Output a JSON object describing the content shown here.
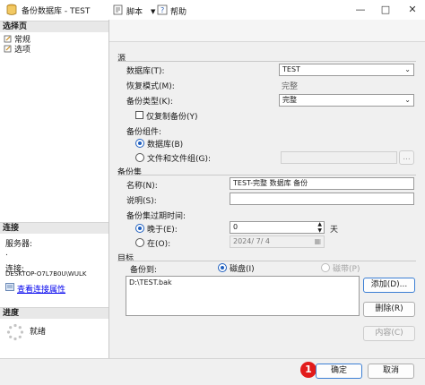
{
  "window": {
    "title": "备份数据库 - TEST",
    "buttons": {
      "minimize": "—",
      "maximize": "□",
      "close": "✕"
    }
  },
  "left": {
    "select_page_header": "选择页",
    "pages": [
      "常规",
      "选项"
    ],
    "connection_header": "连接",
    "server_label": "服务器:",
    "server_value": ".",
    "connection_label": "连接:",
    "connection_value": "DESKTOP-O7L7B0U\\WULK",
    "view_properties_link": "查看连接属性",
    "progress_header": "进度",
    "progress_status": "就绪"
  },
  "toolbar": {
    "script_label": "脚本",
    "help_label": "帮助"
  },
  "source": {
    "group_label": "源",
    "database_label": "数据库(T):",
    "database_value": "TEST",
    "recovery_label": "恢复模式(M):",
    "recovery_value": "完整",
    "backup_type_label": "备份类型(K):",
    "backup_type_value": "完整",
    "copy_only_label": "仅复制备份(Y)",
    "component_label": "备份组件:",
    "component_database": "数据库(B)",
    "component_files": "文件和文件组(G):",
    "browse_label": "..."
  },
  "backup_set": {
    "group_label": "备份集",
    "name_label": "名称(N):",
    "name_value": "TEST-完整 数据库 备份",
    "description_label": "说明(S):",
    "description_value": "",
    "expire_label": "备份集过期时间:",
    "after_label": "晚于(E):",
    "after_value": "0",
    "after_unit": "天",
    "on_label": "在(O):",
    "on_value": "2024/ 7/ 4"
  },
  "destination": {
    "group_label": "目标",
    "backup_to_label": "备份到:",
    "disk_label": "磁盘(I)",
    "tape_label": "磁带(P)",
    "paths": [
      "D:\\TEST.bak"
    ],
    "add_button": "添加(D)...",
    "remove_button": "删除(R)",
    "contents_button": "内容(C)"
  },
  "footer": {
    "marker": "1",
    "ok_button": "确定",
    "cancel_button": "取消"
  },
  "colors": {
    "accent": "#1f5fbf",
    "badge": "#e21b1b",
    "link": "#0000ee"
  }
}
